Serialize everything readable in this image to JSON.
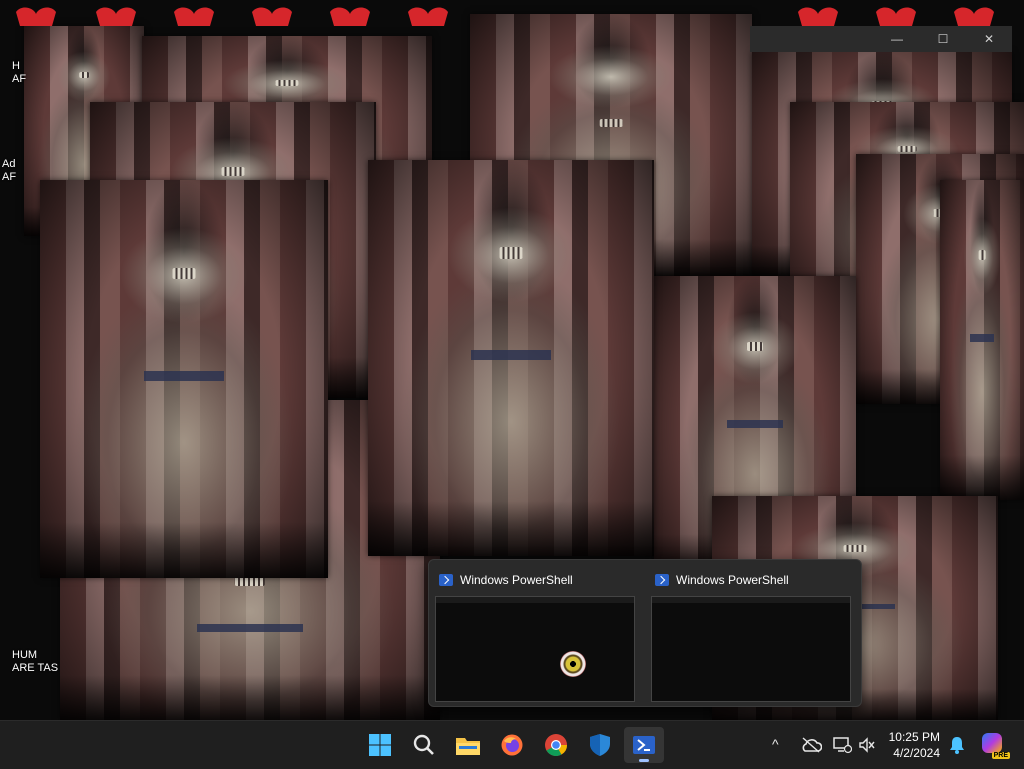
{
  "desktop": {
    "icons": [
      {
        "label": "H\nAF"
      },
      {
        "label": "Ad\nAF"
      },
      {
        "label": "HUM\nARE TAS"
      }
    ]
  },
  "top_window": {
    "minimize_glyph": "—",
    "maximize_glyph": "☐",
    "close_glyph": "✕"
  },
  "thumbnails": [
    {
      "title": "Windows PowerShell"
    },
    {
      "title": "Windows PowerShell"
    }
  ],
  "taskbar": {
    "apps": [
      {
        "name": "start-button",
        "icon": "windows-logo-icon"
      },
      {
        "name": "search-button",
        "icon": "search-icon"
      },
      {
        "name": "file-explorer-button",
        "icon": "folder-icon"
      },
      {
        "name": "firefox-button",
        "icon": "firefox-icon"
      },
      {
        "name": "chrome-button",
        "icon": "chrome-icon"
      },
      {
        "name": "defender-button",
        "icon": "shield-icon"
      },
      {
        "name": "powershell-button",
        "icon": "powershell-icon"
      }
    ],
    "tray": {
      "chevron": "^",
      "time": "10:25 PM",
      "date": "4/2/2024",
      "copilot_badge": "PRE"
    }
  },
  "colors": {
    "taskbar_bg": "#1f1f1f",
    "accent": "#9ec1ff",
    "heart_red": "#d6262b"
  }
}
